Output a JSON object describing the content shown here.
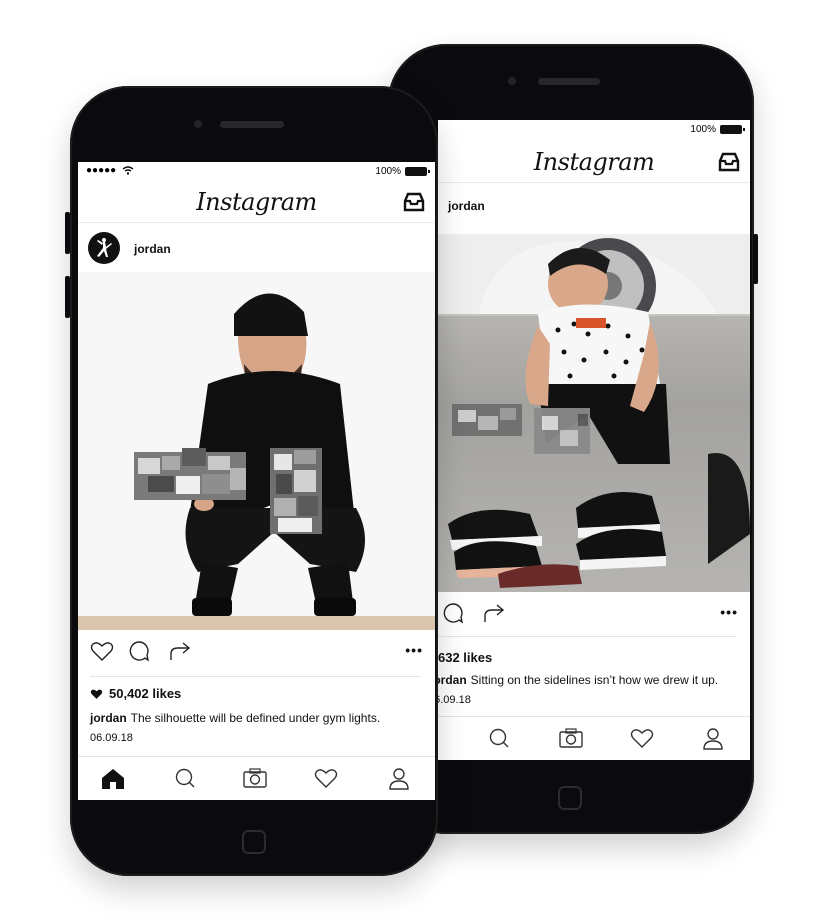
{
  "back_phone": {
    "status": {
      "battery": "100%"
    },
    "header": {
      "brand": "Instagram"
    },
    "post": {
      "username": "jordan",
      "likes": "632 likes",
      "caption_user": "jordan",
      "caption_text": "Sitting on the sidelines isn’t how we drew it up.",
      "date": "06.09.18"
    }
  },
  "front_phone": {
    "status": {
      "signal": "●●●●●",
      "battery": "100%"
    },
    "header": {
      "brand": "Instagram"
    },
    "post": {
      "username": "jordan",
      "likes": "50,402 likes",
      "caption_user": "jordan",
      "caption_text": "The silhouette will be defined under gym lights.",
      "date": "06.09.18"
    }
  },
  "icons": [
    "wifi-icon",
    "battery-icon",
    "inbox-icon",
    "jumpman-logo-icon",
    "heart-icon",
    "comment-icon",
    "share-icon",
    "more-icon",
    "home-icon",
    "search-icon",
    "camera-icon",
    "activity-heart-icon",
    "profile-icon"
  ],
  "colors": {
    "phone_body": "#0b0b0d",
    "screen": "#ffffff",
    "text": "#111111"
  }
}
